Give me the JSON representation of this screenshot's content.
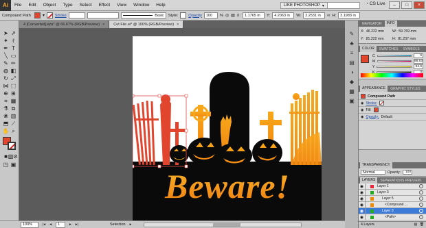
{
  "menubar": {
    "logo": "Ai",
    "menus": [
      "File",
      "Edit",
      "Object",
      "Type",
      "Select",
      "Effect",
      "View",
      "Window",
      "Help"
    ],
    "workspace": "LIKE PHOTOSHOP",
    "cs_live": "CS Live"
  },
  "control": {
    "object_type": "Compound Path",
    "stroke_label": "Stroke",
    "brush_style": "Basic",
    "style_label": "Style:",
    "opacity_label": "Opacity",
    "opacity_value": "100",
    "opacity_unit": "%",
    "x_value": "1.1765 in",
    "y_value": "4.2063 in",
    "w_value": "2.2531 in",
    "h_value": "3.1983 in",
    "fill_color": "#e2452d"
  },
  "tabs": [
    {
      "label": "4 [Converted].eps* @ 66.67% (RGB/Preview)",
      "close": "×"
    },
    {
      "label": "Cut File.ai* @ 100% (RGB/Preview)",
      "close": "×"
    }
  ],
  "status": {
    "zoom": "100%",
    "page": "1",
    "mode": "Selection"
  },
  "artwork": {
    "headline": "Beware!",
    "orange_light": "#f7a81b",
    "orange_dark": "#e2452d",
    "black": "#0a0a0a"
  },
  "panels": {
    "navigator": {
      "tabs": [
        "NAVIGATOR",
        "INFO"
      ],
      "x_label": "X:",
      "x_value": "46.222 mm",
      "y_label": "Y:",
      "y_value": "81.222 mm",
      "w_label": "W:",
      "w_value": "59.769 mm",
      "h_label": "H:",
      "h_value": "81.237 mm"
    },
    "color": {
      "tabs": [
        "COLOR",
        "SWATCHES",
        "SYMBOLS"
      ],
      "channels": [
        {
          "label": "C",
          "value": "0"
        },
        {
          "label": "M",
          "value": "88.63"
        },
        {
          "label": "Y",
          "value": "94.9"
        },
        {
          "label": "K",
          "value": "0"
        }
      ]
    },
    "appearance": {
      "tabs": [
        "APPEARANCE",
        "GRAPHIC STYLES"
      ],
      "title": "Compound Path",
      "stroke_label": "Stroke:",
      "fill_label": "Fill:",
      "opacity_label": "Opacity:",
      "opacity_value": "Default"
    },
    "transparency": {
      "tabs": [
        "TRANSPARENCY"
      ],
      "blend": "Normal",
      "opacity_label": "Opacity:",
      "opacity_value": "100"
    },
    "layers": {
      "tabs": [
        "LAYERS",
        "SEPARATIONS PREVIEW"
      ],
      "rows": [
        {
          "name": "Layer 1"
        },
        {
          "name": "Layer 3"
        },
        {
          "name": "Layer 5"
        },
        {
          "name": "<Compound ..."
        },
        {
          "name": "Layer 3"
        },
        {
          "name": "<Path>"
        }
      ],
      "footer": "4 Layers"
    }
  }
}
